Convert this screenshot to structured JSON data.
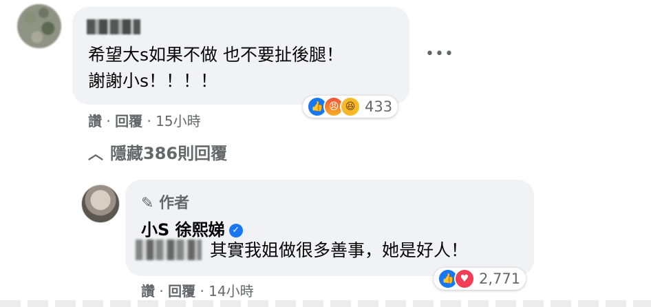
{
  "comment1": {
    "author_redacted": true,
    "line1": "希望大s如果不做 也不要扯後腿！",
    "line2": "謝謝小s！！！！",
    "more_label": "•••",
    "like_label": "讚",
    "reply_label": "回覆",
    "time": "15小時",
    "reaction_count": "433"
  },
  "hide_replies_label": "隱藏386則回覆",
  "reply1": {
    "author_badge": "作者",
    "author_name": "小S 徐熙娣",
    "text": "其實我姐做很多善事，她是好人！",
    "like_label": "讚",
    "reply_label": "回覆",
    "time": "14小時",
    "reaction_count": "2,771"
  }
}
